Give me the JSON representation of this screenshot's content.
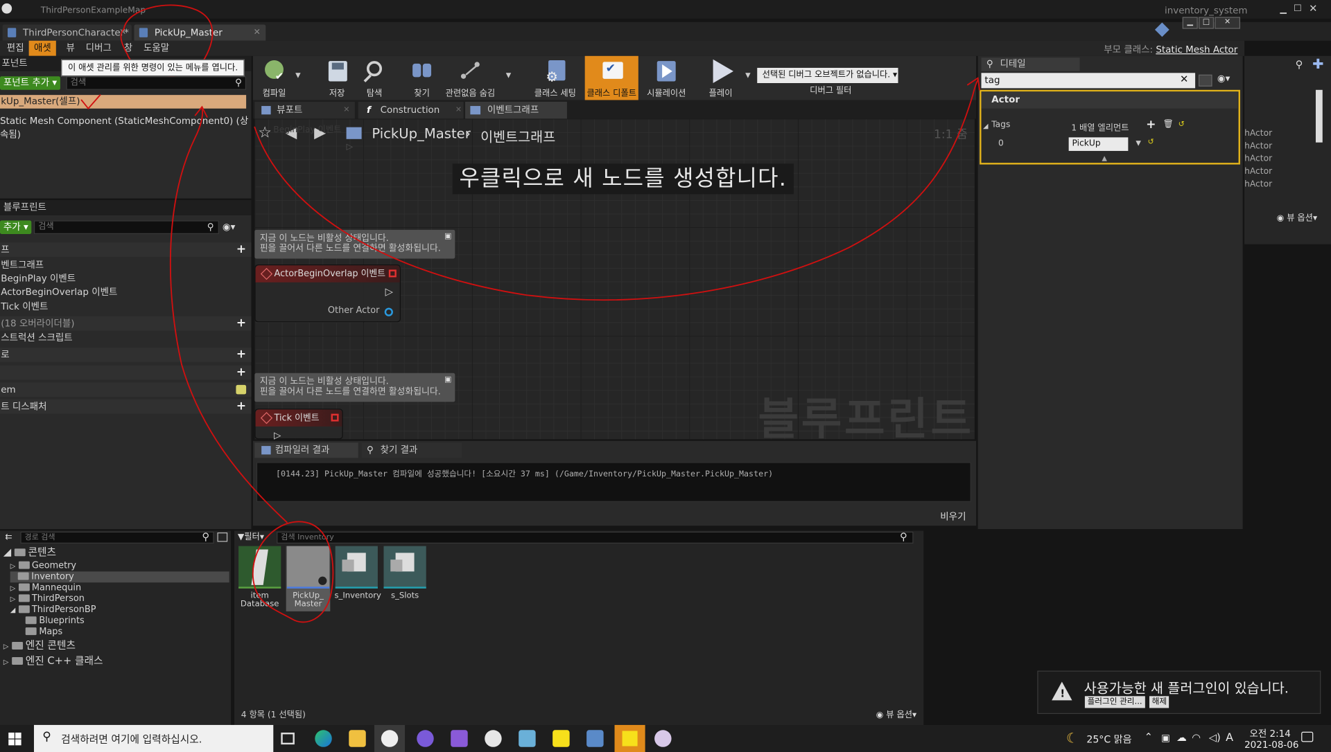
{
  "window": {
    "title": "inventory_system",
    "partial_tab": "ThirdPersonExampleMap"
  },
  "tabs": [
    {
      "label": "ThirdPersonCharacter*"
    },
    {
      "label": "PickUp_Master"
    }
  ],
  "menu": [
    "편집",
    "애셋",
    "뷰",
    "디버그",
    "창",
    "도움말"
  ],
  "menu_tooltip": "이 애셋 관리를 위한 명령이 있는 메뉴를 엽니다.",
  "parent_class": {
    "label": "부모 클래스:",
    "value": "Static Mesh Actor"
  },
  "components": {
    "header": "포넌트",
    "add_button": "포넌트 추가",
    "search_placeholder": "검색",
    "items": [
      "kUp_Master(셀프)",
      "Static Mesh Component (StaticMeshComponent0) (상속됨)"
    ]
  },
  "my_blueprint": {
    "header": "블루프린트",
    "add_button": "추가",
    "search_placeholder": "검색",
    "rows": [
      {
        "label": "프",
        "type": "section"
      },
      {
        "label": "벤트그래프",
        "type": "item"
      },
      {
        "label": "BeginPlay 이벤트",
        "type": "item"
      },
      {
        "label": "ActorBeginOverlap 이벤트",
        "type": "item"
      },
      {
        "label": "Tick 이벤트",
        "type": "item"
      },
      {
        "label": "(18 오버라이더블)",
        "type": "section"
      },
      {
        "label": "스트럭션 스크립트",
        "type": "item"
      },
      {
        "label": "로",
        "type": "section"
      },
      {
        "label": "",
        "type": "section"
      },
      {
        "label": "em",
        "type": "section"
      },
      {
        "label": "트 디스패처",
        "type": "section"
      }
    ]
  },
  "toolbar": {
    "buttons": [
      "컴파일",
      "저장",
      "탐색",
      "찾기",
      "관련없음 숨김",
      "클래스 세팅",
      "클래스 디폴트",
      "시뮬레이션",
      "플레이"
    ],
    "debug_dropdown": "선택된 디버그 오브젝트가 없습니다.",
    "debug_filter": "디버그 필터"
  },
  "graph_tabs": [
    "뷰포트",
    "Construction Scrip",
    "이벤트그래프"
  ],
  "graph": {
    "breadcrumb_blueprint": "PickUp_Master",
    "breadcrumb_graph": "이벤트그래프",
    "zoom": "1:1 줌",
    "hint": "우클릭으로 새 노드를 생성합니다.",
    "ghost_node": "BeginPlay 이벤트",
    "disabled_comment_line1": "지금 이 노드는 비활성 상태입니다.",
    "disabled_comment_line2": "핀을 끌어서 다른 노드를 연결하면 활성화됩니다.",
    "node_overlap": "ActorBeginOverlap 이벤트",
    "node_overlap_pin": "Other Actor",
    "node_tick": "Tick 이벤트",
    "watermark": "블루프린트"
  },
  "output": {
    "tabs": [
      "컴파일러 결과",
      "찾기 결과"
    ],
    "log": "[0144.23] PickUp_Master 컴파일에 성공했습니다! [소요시간 37 ms] (/Game/Inventory/PickUp_Master.PickUp_Master)",
    "clear_button": "비우기"
  },
  "details": {
    "header": "디테일",
    "search_value": "tag",
    "section": "Actor",
    "prop_name": "Tags",
    "prop_summary": "1 배열 엘리먼트",
    "index": "0",
    "tag_value": "PickUp"
  },
  "right_panel": {
    "items": [
      "hActor",
      "hActor",
      "hActor",
      "hActor",
      "hActor"
    ],
    "view_options": "뷰 옵션"
  },
  "content_browser": {
    "path_search": "경로 검색",
    "filter_button": "필터",
    "search_placeholder": "검색 Inventory",
    "tree": [
      {
        "label": "콘텐츠",
        "level": 0
      },
      {
        "label": "Geometry",
        "level": 1
      },
      {
        "label": "Inventory",
        "level": 1,
        "selected": true
      },
      {
        "label": "Mannequin",
        "level": 1
      },
      {
        "label": "ThirdPerson",
        "level": 1
      },
      {
        "label": "ThirdPersonBP",
        "level": 1
      },
      {
        "label": "Blueprints",
        "level": 2
      },
      {
        "label": "Maps",
        "level": 2
      },
      {
        "label": "엔진 콘텐츠",
        "level": 0
      },
      {
        "label": "엔진 C++ 클래스",
        "level": 0
      }
    ],
    "assets": [
      {
        "line1": "item",
        "line2": "Database"
      },
      {
        "line1": "PickUp_",
        "line2": "Master"
      },
      {
        "line1": "s_Inventory",
        "line2": ""
      },
      {
        "line1": "s_Slots",
        "line2": ""
      }
    ],
    "status": "4 항목 (1 선택됨)",
    "view_options": "뷰 옵션"
  },
  "notification": {
    "title": "사용가능한 새 플러그인이 있습니다.",
    "manage_button": "플러그인 관리...",
    "dismiss_button": "해제"
  },
  "taskbar": {
    "search_placeholder": "검색하려면 여기에 입력하십시오.",
    "weather": "25°C 맑음",
    "ime": "A",
    "time": "오전 2:14",
    "date": "2021-08-06"
  },
  "colors": {
    "accent": "#e18a1b",
    "green": "#3d8a1f",
    "annotation": "#d01010"
  }
}
